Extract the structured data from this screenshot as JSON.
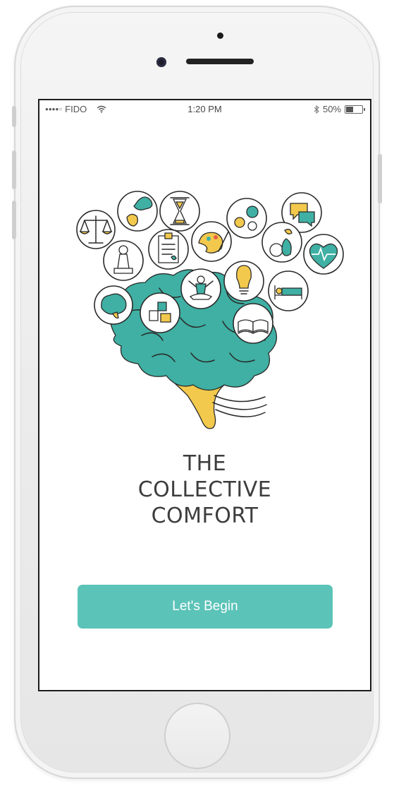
{
  "status_bar": {
    "carrier": "FIDO",
    "time": "1:20 PM",
    "battery_percent": "50%",
    "battery_level": 0.5
  },
  "app": {
    "title_line1": "THE",
    "title_line2": "COLLECTIVE",
    "title_line3": "COMFORT",
    "cta_label": "Let's Begin"
  },
  "colors": {
    "accent": "#5bc3b8",
    "brain_teal": "#3fb0a3",
    "brain_stem_yellow": "#f2c94c",
    "title_text": "#3d3d3d"
  },
  "icons": [
    "scales-icon",
    "thinking-head-icon",
    "hourglass-icon",
    "gears-icon",
    "chat-bubbles-icon",
    "chess-pawn-icon",
    "clipboard-icon",
    "paint-palette-icon",
    "fruit-icon",
    "heartbeat-icon",
    "brain-icon",
    "puzzle-icon",
    "meditation-icon",
    "lightbulb-icon",
    "bed-icon",
    "open-book-icon"
  ]
}
